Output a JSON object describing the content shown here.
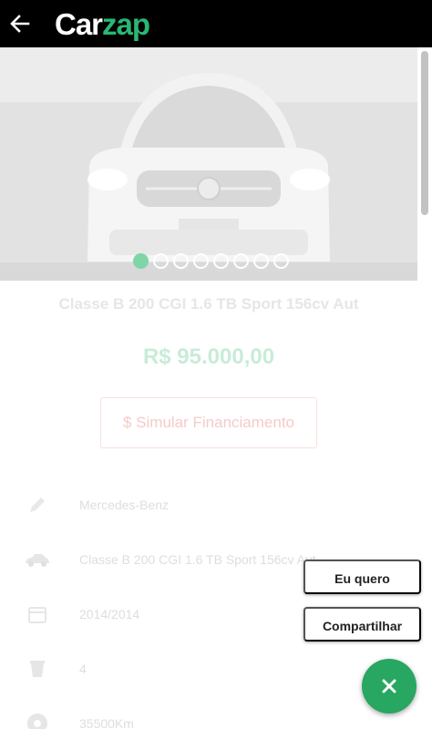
{
  "header": {
    "back_icon": "arrow-left-icon",
    "logo_part1": "Car",
    "logo_part2": "zap",
    "logo_colors": {
      "text": "#ffffff",
      "accent": "#2bb673",
      "bar": "#000000"
    }
  },
  "gallery": {
    "image": "car-front-photo",
    "photo_count": 8,
    "active_index": 0
  },
  "listing": {
    "title": "Classe B 200 CGI 1.6 TB Sport 156cv Aut",
    "price": "R$ 95.000,00",
    "financing_button": "$ Simular Financiamento"
  },
  "specs": [
    {
      "icon": "pencil-icon",
      "value": "Mercedes-Benz"
    },
    {
      "icon": "car-model-icon",
      "value": "Classe B 200 CGI 1.6 TB Sport 156cv Aut"
    },
    {
      "icon": "calendar-icon",
      "value": "2014/2014"
    },
    {
      "icon": "door-icon",
      "value": "4"
    },
    {
      "icon": "speedometer-icon",
      "value": "35500Km"
    }
  ],
  "actions": {
    "want_label": "Eu quero",
    "share_label": "Compartilhar",
    "close_icon": "close-icon",
    "fab_color": "#27a761"
  }
}
